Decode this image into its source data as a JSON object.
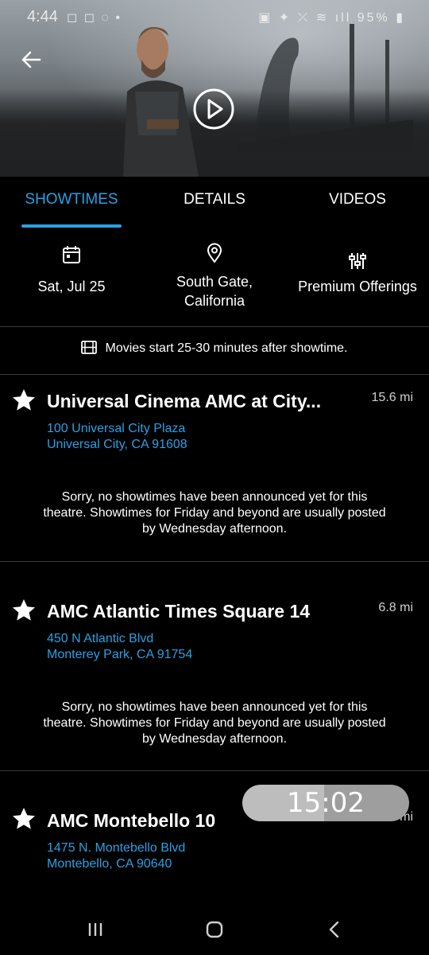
{
  "status_bar": {
    "time": "4:44",
    "battery": "95%"
  },
  "hero": {
    "back_icon": "arrow-left-icon",
    "play_icon": "play-circle-icon"
  },
  "tabs": [
    {
      "label": "SHOWTIMES",
      "active": true
    },
    {
      "label": "DETAILS",
      "active": false
    },
    {
      "label": "VIDEOS",
      "active": false
    }
  ],
  "filters": {
    "date": {
      "icon": "calendar-icon",
      "label": "Sat, Jul 25"
    },
    "location": {
      "icon": "location-pin-icon",
      "line1": "South Gate,",
      "line2": "California"
    },
    "offerings": {
      "icon": "sliders-icon",
      "label": "Premium Offerings"
    }
  },
  "notice": {
    "icon": "film-icon",
    "text": "Movies start 25-30 minutes after showtime."
  },
  "theatres": [
    {
      "name": "Universal Cinema AMC at City...",
      "distance": "15.6 mi",
      "address1": "100 Universal City Plaza",
      "address2": "Universal City, CA  91608",
      "message": [
        "Sorry, no showtimes have been announced yet for this",
        "theatre. Showtimes for Friday and beyond are usually posted",
        "by Wednesday afternoon."
      ]
    },
    {
      "name": "AMC Atlantic Times Square 14",
      "distance": "6.8 mi",
      "address1": "450 N Atlantic Blvd",
      "address2": "Monterey Park, CA  91754",
      "message": [
        "Sorry, no showtimes have been announced yet for this",
        "theatre. Showtimes for Friday and beyond are usually posted",
        "by Wednesday afternoon."
      ]
    },
    {
      "name": "AMC Montebello 10",
      "distance": "mi",
      "address1": "1475 N. Montebello Blvd",
      "address2": "Montebello, CA  90640"
    }
  ],
  "timer": {
    "text": "15:02"
  },
  "colors": {
    "accent": "#2aa0e3",
    "background": "#000000",
    "divider": "#3a3a3a"
  }
}
